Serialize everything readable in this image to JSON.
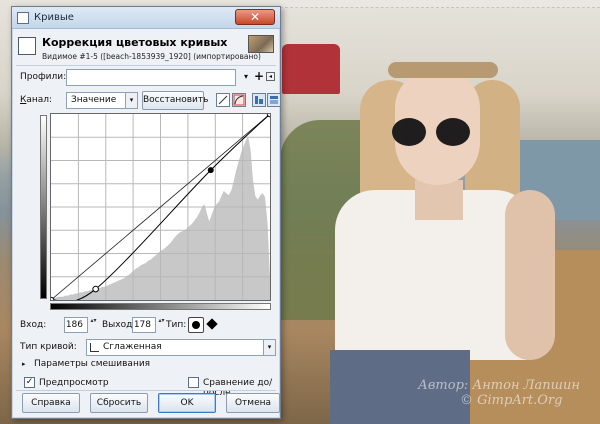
{
  "window": {
    "title": "Кривые",
    "close_symbol": "✕"
  },
  "header": {
    "title": "Коррекция цветовых кривых",
    "subtitle": "Видимое #1-5 ([beach-1853939_1920] (импортировано)"
  },
  "profiles": {
    "label": "Профили:",
    "value": "",
    "add_symbol": "+",
    "arrow_symbol": "▾",
    "menu_symbol": "◂"
  },
  "channel": {
    "label_prefix": "К",
    "label_rest": "анал:",
    "value": "Значение",
    "arrow_symbol": "▾",
    "reset_label": "Восстановить"
  },
  "coords": {
    "input_label": "Вход:",
    "input_value": "186",
    "output_label": "Выход:",
    "output_value": "178",
    "type_label": "Тип:",
    "spin_symbol": "▴▾"
  },
  "curve_type": {
    "label": "Тип кривой:",
    "value": "Сглаженная",
    "arrow_symbol": "▾"
  },
  "blend": {
    "expander_symbol": "▸",
    "label": "Параметры смешивания"
  },
  "preview": {
    "label": "Предпросмотр",
    "checked_symbol": "✓",
    "split_label": "Сравнение до/после",
    "split_checked_symbol": ""
  },
  "buttons": {
    "help": "Справка",
    "reset": "Сбросить",
    "ok": "OK",
    "cancel": "Отмена"
  },
  "curve": {
    "points": [
      [
        0,
        0
      ],
      [
        52,
        15
      ],
      [
        186,
        178
      ],
      [
        255,
        255
      ]
    ],
    "histogram": [
      2,
      2,
      2,
      3,
      3,
      3,
      4,
      4,
      5,
      5,
      6,
      6,
      7,
      7,
      8,
      8,
      9,
      9,
      10,
      10,
      11,
      12,
      12,
      13,
      14,
      15,
      16,
      17,
      18,
      19,
      20,
      22,
      23,
      25,
      27,
      29,
      30,
      32,
      33,
      34,
      36,
      37,
      39,
      41,
      43,
      45,
      46,
      48,
      50,
      52,
      55,
      58,
      60,
      62,
      63,
      64,
      66,
      68,
      70,
      73,
      76,
      80,
      85,
      88,
      80,
      72,
      78,
      84,
      88,
      90,
      95,
      100,
      98,
      96,
      100,
      108,
      118,
      126,
      134,
      140,
      146,
      150,
      138,
      110,
      95,
      92,
      96,
      98,
      94,
      70,
      20
    ],
    "colors": {
      "grid": "#b8b8b8",
      "curve": "#000000",
      "histogram": "#c8c8c8"
    }
  },
  "watermark": {
    "line1": "Автор: Антон Лапшин",
    "line2": "© GimpArt.Org"
  }
}
